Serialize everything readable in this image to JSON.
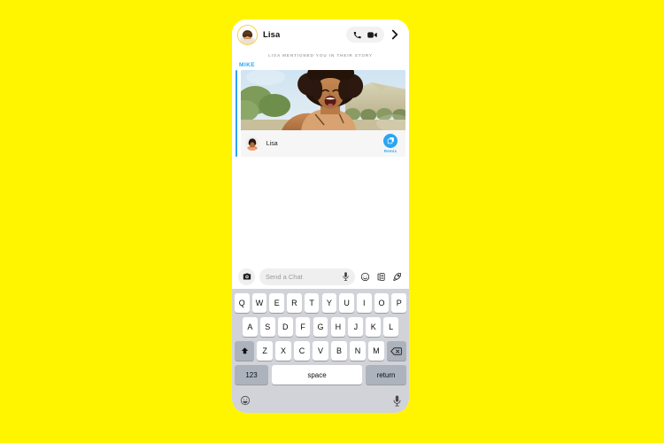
{
  "background": {
    "color": "#FFF500"
  },
  "phone": {
    "app": "Snapchat Chat",
    "accent_blue": "#2BA5F2",
    "brand_yellow": "#FFFC00"
  },
  "header": {
    "avatar_name": "lisa-avatar",
    "contact_name": "Lisa",
    "actions": [
      {
        "name": "voice-call-icon",
        "label": "Voice call"
      },
      {
        "name": "video-call-icon",
        "label": "Video call"
      }
    ],
    "chevron_label": "Open profile"
  },
  "conversation": {
    "story_notice": "LISA MENTIONED YOU IN THEIR STORY",
    "message": {
      "sender_header": "MIKE",
      "snap_sender": "Lisa",
      "remix_label": "Remix",
      "accent_color": "#2BA5F2"
    }
  },
  "chat_input": {
    "placeholder": "Send a Chat",
    "camera_icon": "camera-icon",
    "mic_icon": "microphone-icon",
    "icons": [
      {
        "name": "emoji-icon",
        "label": "Emoji"
      },
      {
        "name": "sticker-icon",
        "label": "Stickers"
      },
      {
        "name": "rocket-icon",
        "label": "Send"
      }
    ]
  },
  "keyboard": {
    "row1": [
      "Q",
      "W",
      "E",
      "R",
      "T",
      "Y",
      "U",
      "I",
      "O",
      "P"
    ],
    "row2": [
      "A",
      "S",
      "D",
      "F",
      "G",
      "H",
      "J",
      "K",
      "L"
    ],
    "row3": [
      "Z",
      "X",
      "C",
      "V",
      "B",
      "N",
      "M"
    ],
    "shift_label": "shift",
    "backspace_label": "delete",
    "numbers_key": "123",
    "space_key": "space",
    "return_key": "return",
    "accessory": {
      "emoji_label": "emoji-keyboard",
      "dictation_label": "dictation"
    }
  }
}
